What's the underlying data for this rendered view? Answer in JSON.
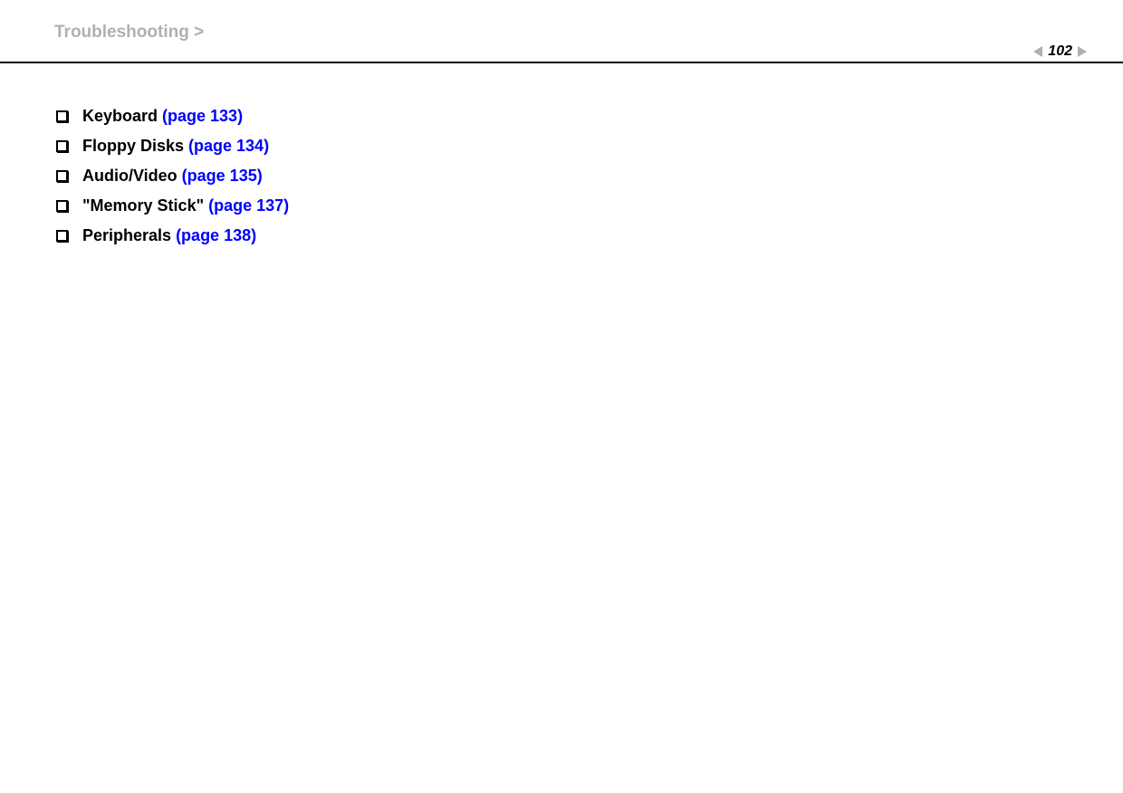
{
  "header": {
    "breadcrumb": "Troubleshooting >",
    "page_number": "102"
  },
  "items": [
    {
      "label": "Keyboard",
      "link": "(page 133)"
    },
    {
      "label": "Floppy Disks",
      "link": "(page 134)"
    },
    {
      "label": "Audio/Video",
      "link": "(page 135)"
    },
    {
      "label": "\"Memory Stick\"",
      "link": "(page 137)"
    },
    {
      "label": "Peripherals",
      "link": "(page 138)"
    }
  ]
}
